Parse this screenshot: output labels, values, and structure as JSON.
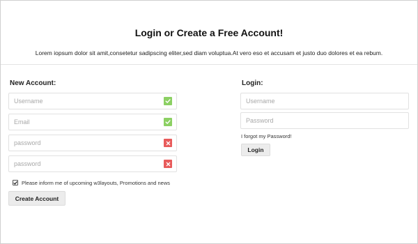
{
  "header": {
    "title": "Login or Create a Free Account!",
    "subtitle": "Lorem iopsum dolor sit amit,consetetur sadipscing eliter,sed diam voluptua.At vero eso et accusam et justo duo dolores et ea rebum."
  },
  "new_account": {
    "heading": "New Account:",
    "fields": [
      {
        "placeholder": "Username",
        "status": "valid",
        "status_color": "#8cd063",
        "icon": "check-icon"
      },
      {
        "placeholder": "Email",
        "status": "valid",
        "status_color": "#8cd063",
        "icon": "check-icon"
      },
      {
        "placeholder": "password",
        "status": "invalid",
        "status_color": "#e85b5b",
        "icon": "cross-icon"
      },
      {
        "placeholder": "password",
        "status": "invalid",
        "status_color": "#e85b5b",
        "icon": "cross-icon"
      }
    ],
    "newsletter": {
      "checked": true,
      "label": "Please inform me of upcoming w3layouts, Promotions and news"
    },
    "submit_label": "Create Account"
  },
  "login": {
    "heading": "Login:",
    "username_placeholder": "Username",
    "password_placeholder": "Password",
    "forgot_label": "I forgot my Password!",
    "submit_label": "Login"
  },
  "colors": {
    "valid": "#8cd063",
    "invalid": "#e85b5b",
    "button_bg": "#ececec",
    "field_border": "#e1e1e1"
  }
}
